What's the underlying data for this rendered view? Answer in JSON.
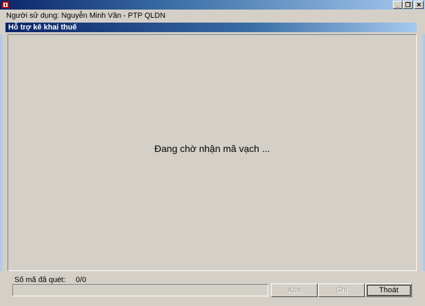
{
  "window": {
    "title": ""
  },
  "user_bar": {
    "text": "Người sử dụng: Nguyễn Minh Vân - PTP QLDN"
  },
  "panel": {
    "title": "Hỗ trợ kê khai thuế"
  },
  "main": {
    "waiting_message": "Đang chờ nhận mã vạch ..."
  },
  "status": {
    "label": "Số mã đã quét:",
    "value": "0/0"
  },
  "buttons": {
    "delete": "Xóa",
    "save": "Ghi",
    "exit": "Thoát"
  },
  "icons": {
    "minimize": "minimize-icon",
    "restore": "restore-icon",
    "close": "close-icon",
    "app": "app-icon"
  },
  "colors": {
    "titlebar": "#0a246a",
    "face": "#d4d0c8"
  }
}
